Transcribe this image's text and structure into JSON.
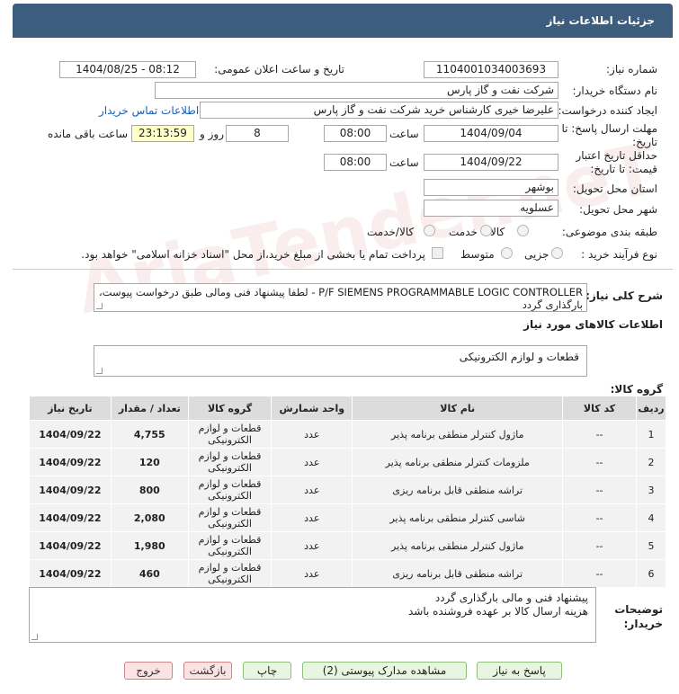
{
  "header": {
    "title": "جزئیات اطلاعات نیاز"
  },
  "watermark": {
    "text": "AriaTender.neT"
  },
  "form": {
    "need_number_label": "شماره نیاز:",
    "need_number": "1104001034003693",
    "announce_label": "تاریخ و ساعت اعلان عمومی:",
    "announce_value": "1404/08/25 - 08:12",
    "buyer_org_label": "نام دستگاه خریدار:",
    "buyer_org": "شرکت نفت و گاز پارس",
    "creator_label": "ایجاد کننده درخواست:",
    "creator": "علیرضا  خیری کارشناس خرید  شرکت نفت و گاز پارس",
    "contact_link": "اطلاعات تماس خریدار",
    "reply_deadline_label": "مهلت ارسال پاسخ: تا تاریخ:",
    "reply_date": "1404/09/04",
    "time_label": "ساعت",
    "reply_time": "08:00",
    "days": "8",
    "days_label": "روز و",
    "remaining": "23:13:59",
    "remaining_label": "ساعت باقی مانده",
    "min_validity_label": "حداقل تاریخ اعتبار قیمت: تا تاریخ:",
    "validity_date": "1404/09/22",
    "validity_time": "08:00",
    "province_label": "استان محل تحویل:",
    "province": "بوشهر",
    "city_label": "شهر محل تحویل:",
    "city": "عسلویه",
    "category_label": "طبقه بندی موضوعی:",
    "category_options": [
      "کالا",
      "خدمت",
      "کالا/خدمت"
    ],
    "purchase_type_label": "نوع فرآیند خرید :",
    "purchase_options": [
      "جزیی",
      "متوسط"
    ],
    "payment_note": "پرداخت تمام یا بخشی از مبلغ خرید،از محل \"اسناد خزانه اسلامی\" خواهد بود.",
    "desc_label": "شرح کلی نیاز:",
    "desc_line1": "P/F SIEMENS PROGRAMMABLE LOGIC CONTROLLER - لطفا پیشنهاد فنی ومالی طبق درخواست پیوست،",
    "desc_line2": "بارگذاری گردد",
    "goods_info_title": "اطلاعات کالاهای مورد نیاز",
    "goods_group_label": "گروه کالا:",
    "goods_group": "قطعات و لوازم الکترونیکی"
  },
  "table": {
    "headers": [
      "ردیف",
      "کد کالا",
      "نام کالا",
      "واحد شمارش",
      "گروه کالا",
      "تعداد / مقدار",
      "تاریخ نیاز"
    ],
    "rows": [
      [
        "1",
        "--",
        "ماژول کنترلر منطقی برنامه پذیر",
        "عدد",
        "قطعات و لوازم الکترونیکی",
        "4,755",
        "1404/09/22"
      ],
      [
        "2",
        "--",
        "ملزومات کنترلر منطقی برنامه پذیر",
        "عدد",
        "قطعات و لوازم الکترونیکی",
        "120",
        "1404/09/22"
      ],
      [
        "3",
        "--",
        "تراشه منطقی قابل برنامه ریزی",
        "عدد",
        "قطعات و لوازم الکترونیکی",
        "800",
        "1404/09/22"
      ],
      [
        "4",
        "--",
        "شاسی کنترلر منطقی برنامه پذیر",
        "عدد",
        "قطعات و لوازم الکترونیکی",
        "2,080",
        "1404/09/22"
      ],
      [
        "5",
        "--",
        "ماژول کنترلر منطقی برنامه پذیر",
        "عدد",
        "قطعات و لوازم الکترونیکی",
        "1,980",
        "1404/09/22"
      ],
      [
        "6",
        "--",
        "تراشه منطقی قابل برنامه ریزی",
        "عدد",
        "قطعات و لوازم الکترونیکی",
        "460",
        "1404/09/22"
      ]
    ]
  },
  "notes": {
    "label": "توضیحات خریدار:",
    "line1": "پیشنهاد فنی و مالی بارگذاری گردد",
    "line2": "هزینه ارسال کالا بر عهده فروشنده باشد"
  },
  "buttons": {
    "reply": "پاسخ به نیاز",
    "view_docs": "مشاهده مدارک پیوستی (2)",
    "print": "چاپ",
    "back": "بازگشت",
    "exit": "خروج"
  }
}
